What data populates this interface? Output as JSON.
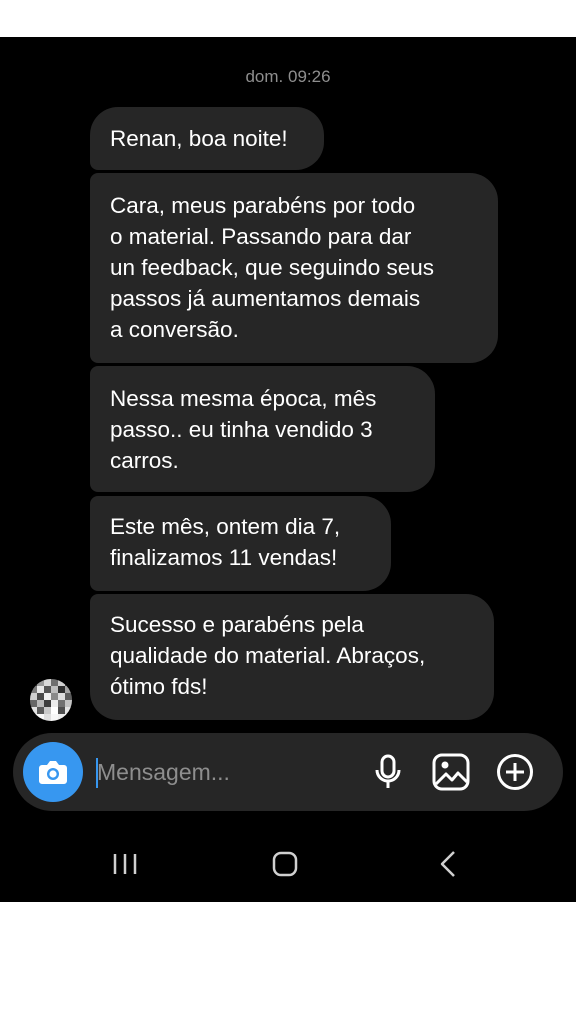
{
  "conversation": {
    "timestamp": "dom. 09:26",
    "messages": [
      {
        "text": "Renan, boa noite!"
      },
      {
        "text": "Cara, meus parabéns por todo\no material. Passando para dar\nun feedback, que seguindo seus\npassos já aumentamos demais\na conversão."
      },
      {
        "text": "Nessa mesma época, mês\npasso.. eu tinha vendido 3\ncarros."
      },
      {
        "text": "Este mês, ontem dia 7,\nfinalizamos 11 vendas!"
      },
      {
        "text": "Sucesso e parabéns pela\nqualidade do material. Abraços,\nótimo fds!"
      }
    ]
  },
  "composer": {
    "placeholder": "Mensagem...",
    "value": "",
    "icons": [
      "camera-icon",
      "microphone-icon",
      "gallery-icon",
      "plus-circle-icon"
    ]
  },
  "navigation": {
    "icons": [
      "recent-apps-icon",
      "home-icon",
      "back-icon"
    ]
  },
  "colors": {
    "background": "#000000",
    "bubble": "#262626",
    "accent": "#3797f0",
    "timestamp": "#8e8e8e"
  }
}
